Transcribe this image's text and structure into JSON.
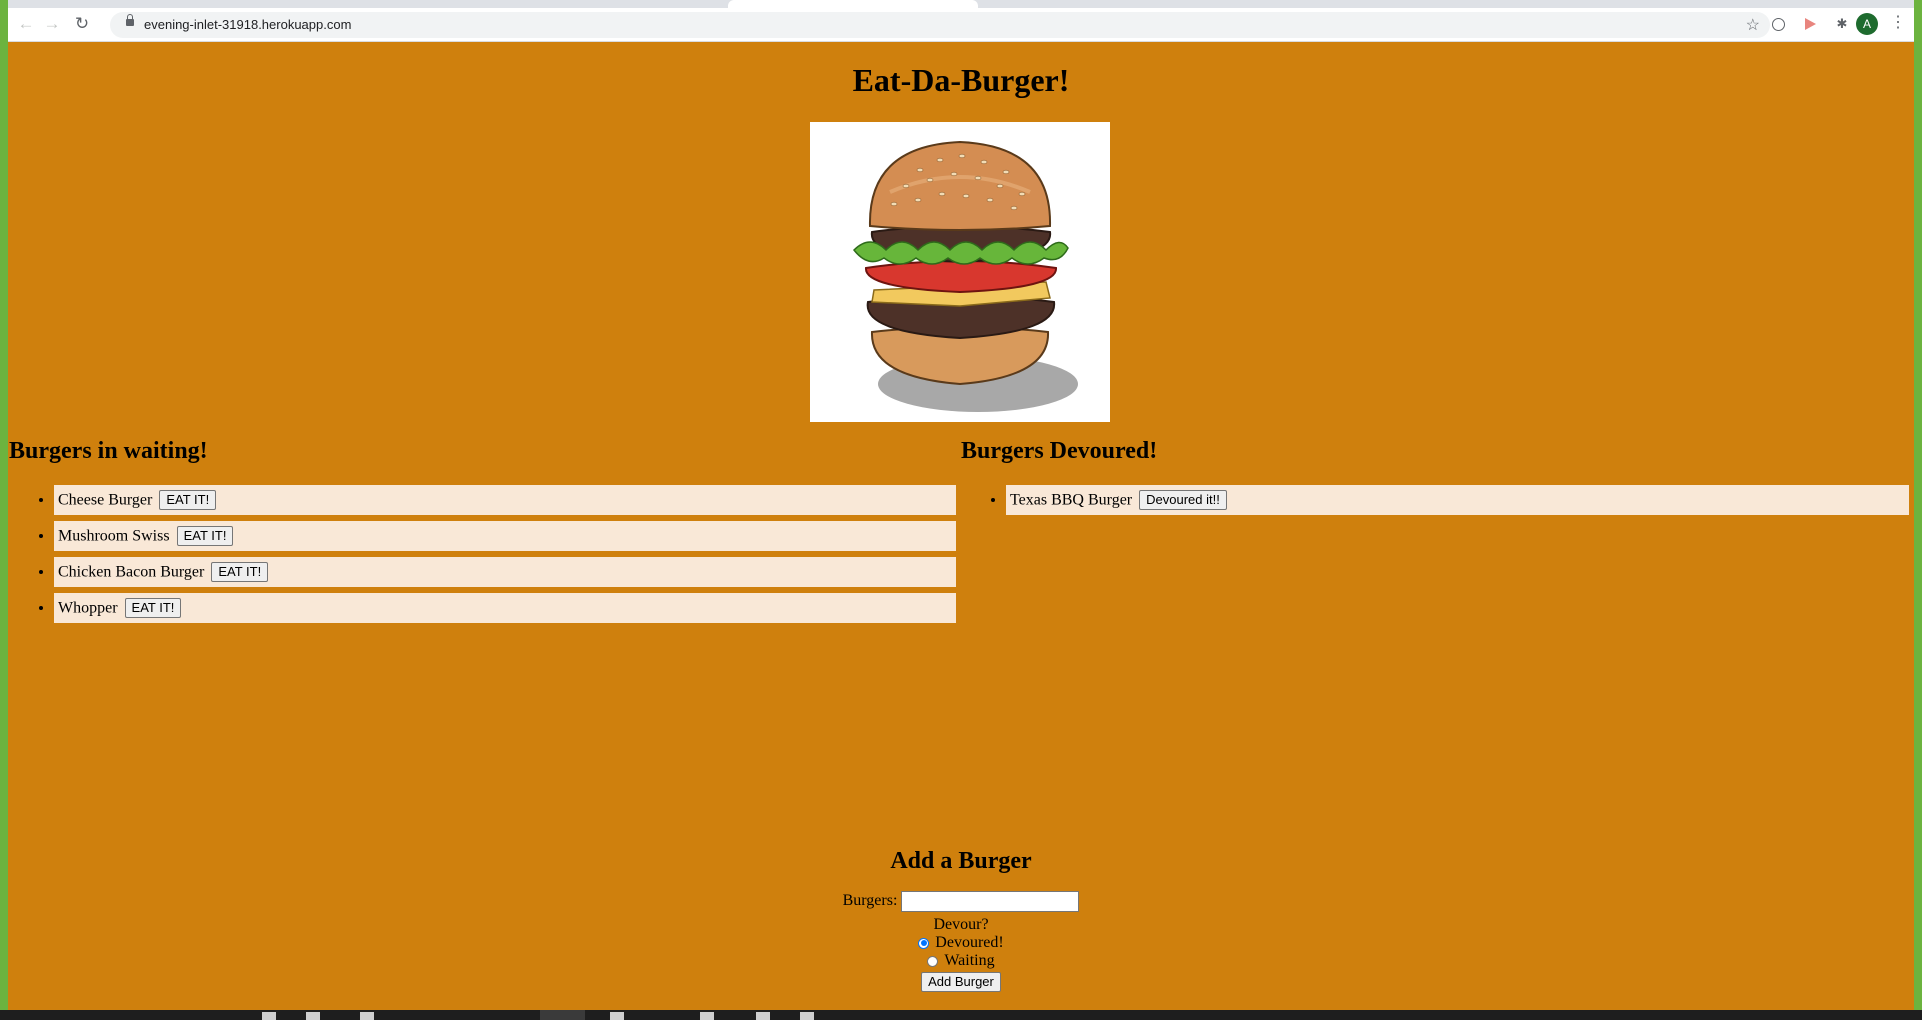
{
  "browser": {
    "url": "evening-inlet-31918.herokuapp.com",
    "back_icon": "←",
    "forward_icon": "→",
    "reload_icon": "↻",
    "star_icon": "☆",
    "extensions_icon": "✱",
    "menu_icon": "⋮",
    "profile_initial": "A"
  },
  "page": {
    "title": "Eat-Da-Burger!",
    "waiting": {
      "heading": "Burgers in waiting!",
      "items": [
        {
          "name": "Cheese Burger",
          "button": "EAT IT!"
        },
        {
          "name": "Mushroom Swiss",
          "button": "EAT IT!"
        },
        {
          "name": "Chicken Bacon Burger",
          "button": "EAT IT!"
        },
        {
          "name": "Whopper",
          "button": "EAT IT!"
        }
      ]
    },
    "devoured": {
      "heading": "Burgers Devoured!",
      "items": [
        {
          "name": "Texas BBQ Burger",
          "button": "Devoured it!!"
        }
      ]
    },
    "form": {
      "heading": "Add a Burger",
      "burgers_label": "Burgers:",
      "burgers_value": "",
      "devour_label": "Devour?",
      "options": [
        {
          "label": "Devoured!",
          "checked": true
        },
        {
          "label": "Waiting",
          "checked": false
        }
      ],
      "submit_label": "Add Burger"
    }
  },
  "colors": {
    "page_background": "#cf800d",
    "list_item_background": "#f9e8d7",
    "radio_accent": "#0075ff"
  }
}
